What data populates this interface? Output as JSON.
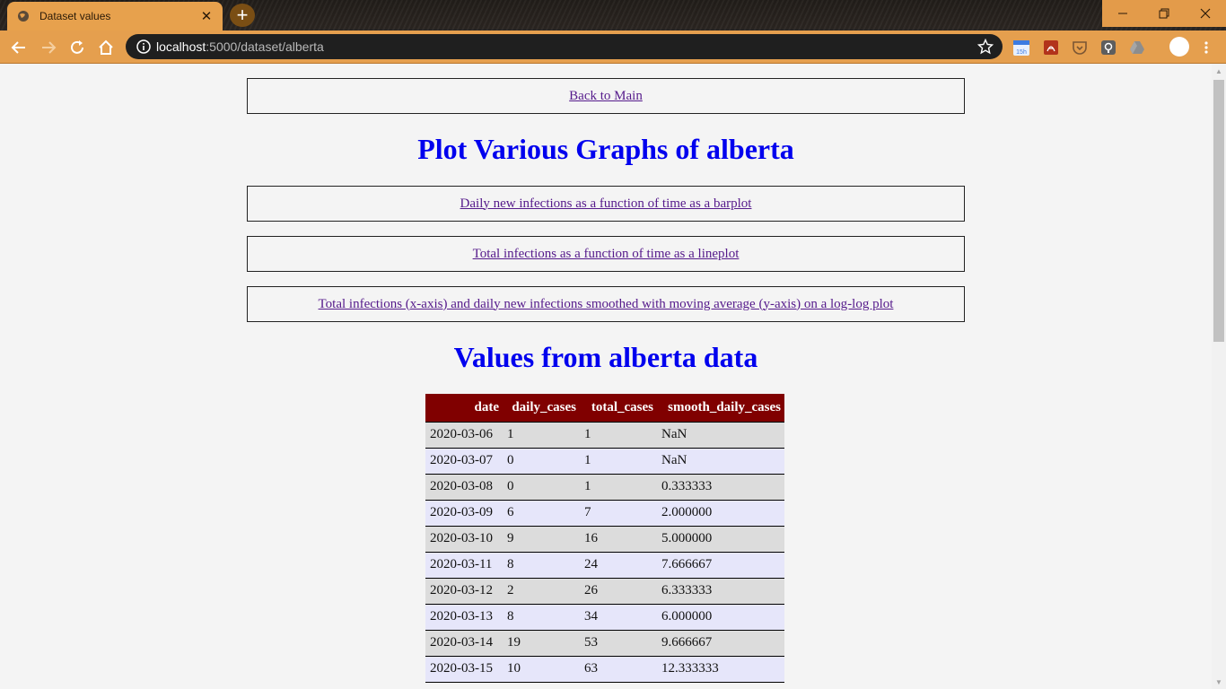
{
  "browser": {
    "tab_title": "Dataset values",
    "url_host": "localhost",
    "url_path": ":5000/dataset/alberta",
    "ext_badge": "15h"
  },
  "page": {
    "back_link": "Back to Main",
    "plot_heading": "Plot Various Graphs of alberta",
    "plot_links": [
      "Daily new infections as a function of time as a barplot",
      "Total infections as a function of time as a lineplot",
      "Total infections (x-axis) and daily new infections smoothed with moving average (y-axis) on a log-log plot"
    ],
    "values_heading": "Values from alberta data",
    "table": {
      "headers": [
        "date",
        "daily_cases",
        "total_cases",
        "smooth_daily_cases"
      ],
      "rows": [
        [
          "2020-03-06",
          "1",
          "1",
          "NaN"
        ],
        [
          "2020-03-07",
          "0",
          "1",
          "NaN"
        ],
        [
          "2020-03-08",
          "0",
          "1",
          "0.333333"
        ],
        [
          "2020-03-09",
          "6",
          "7",
          "2.000000"
        ],
        [
          "2020-03-10",
          "9",
          "16",
          "5.000000"
        ],
        [
          "2020-03-11",
          "8",
          "24",
          "7.666667"
        ],
        [
          "2020-03-12",
          "2",
          "26",
          "6.333333"
        ],
        [
          "2020-03-13",
          "8",
          "34",
          "6.000000"
        ],
        [
          "2020-03-14",
          "19",
          "53",
          "9.666667"
        ],
        [
          "2020-03-15",
          "10",
          "63",
          "12.333333"
        ]
      ]
    }
  },
  "colors": {
    "chrome_accent": "#e59f4e",
    "heading": "#0000ee",
    "link": "#551a8b",
    "table_header": "#800000",
    "row_odd": "#dcdcdc",
    "row_even": "#e6e6fa"
  },
  "icons": [
    "globe-icon",
    "close-icon",
    "plus-icon",
    "back-icon",
    "forward-icon",
    "reload-icon",
    "home-icon",
    "info-icon",
    "star-icon",
    "calendar-icon",
    "pdf-icon",
    "pocket-icon",
    "lens-icon",
    "drive-icon",
    "profile-icon",
    "menu-icon"
  ]
}
